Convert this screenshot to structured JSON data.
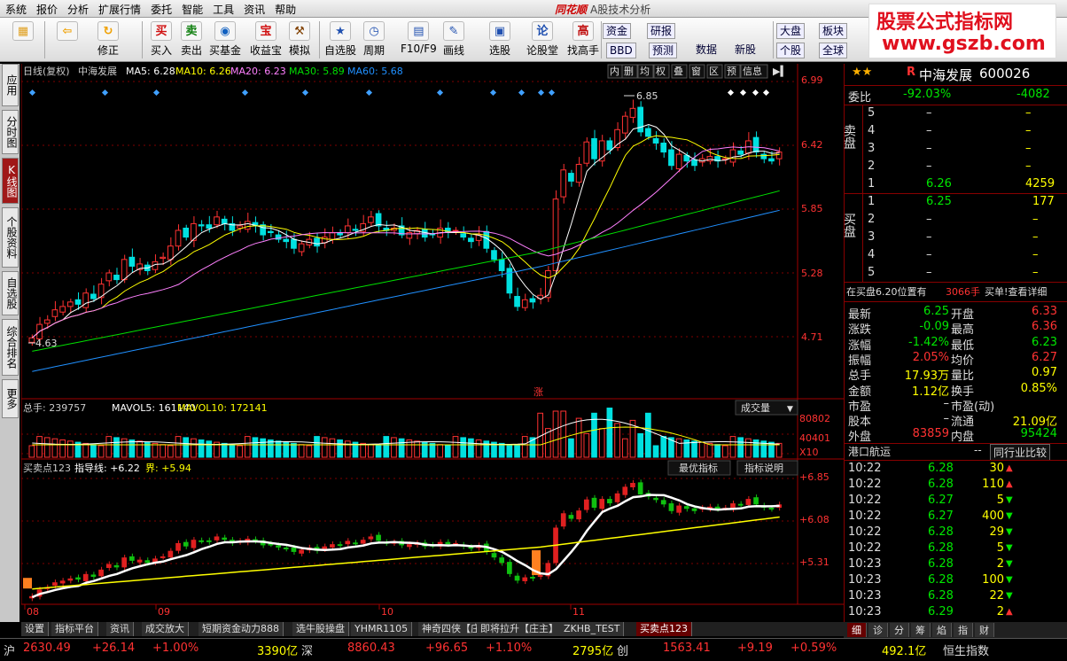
{
  "menu": [
    "系统",
    "报价",
    "分析",
    "扩展行情",
    "委托",
    "智能",
    "工具",
    "资讯",
    "帮助"
  ],
  "app_title": {
    "brand": "同花顺",
    "sub": "A股技术分析"
  },
  "watermark": {
    "line1": "股票公式指标网",
    "line2": "www.gszb.com"
  },
  "toolbar": [
    {
      "label": "",
      "icon": "grid-icon"
    },
    {
      "label": "",
      "icon": "back-arrow-icon"
    },
    {
      "label": "修正",
      "icon": "refresh-icon"
    },
    {
      "label": "买入",
      "icon": "买"
    },
    {
      "label": "卖出",
      "icon": "卖"
    },
    {
      "label": "买基金",
      "icon": "fund-icon"
    },
    {
      "label": "收益宝",
      "icon": "宝"
    },
    {
      "label": "模拟",
      "icon": "hammer-icon"
    },
    {
      "label": "自选股",
      "icon": "star-icon"
    },
    {
      "label": "周期",
      "icon": "clock-icon"
    },
    {
      "label": "F10/F9",
      "icon": "f10-icon"
    },
    {
      "label": "画线",
      "icon": "pen-icon"
    },
    {
      "label": "选股",
      "icon": "select-icon"
    },
    {
      "label": "论股堂",
      "icon": "论"
    },
    {
      "label": "找高手",
      "icon": "高"
    }
  ],
  "toolbar_small": {
    "zijin": "资金",
    "bbd": "BBD",
    "yanbao": "研报",
    "yuce": "预测",
    "shuju": "数据",
    "xinfu": "新股",
    "dapan": "大盘",
    "gegu": "个股",
    "banku": "板块",
    "quanqiu": "全球"
  },
  "left_tabs": [
    "应用",
    "分时图",
    "K线图",
    "个股资料",
    "自选股",
    "综合排名",
    "更多"
  ],
  "left_tab_active": 2,
  "kline_header": {
    "period": "日线(复权)",
    "name": "中海发展",
    "ma5": "MA5: 6.28",
    "ma10": "MA10: 6.26",
    "ma20": "MA20: 6.23",
    "ma30": "MA30: 5.89",
    "ma60": "MA60: 5.68",
    "ma5_color": "#ffffff",
    "ma10_color": "#ffff00",
    "ma20_color": "#ff80ff",
    "ma30_color": "#00e000",
    "ma60_color": "#2090ff"
  },
  "kline_tools": [
    "内",
    "删",
    "均",
    "权",
    "叠",
    "窗",
    "区",
    "预",
    "信息"
  ],
  "price_axis": [
    "6.99",
    "6.42",
    "5.85",
    "5.28",
    "4.71"
  ],
  "annotations": {
    "high": "6.85",
    "low": "4.63",
    "zhang": "涨"
  },
  "volume_header": {
    "total": "总手: 239757",
    "mavol5": "MAVOL5: 161140",
    "mavol10": "MAVOL10: 172141",
    "selector": "成交量"
  },
  "volume_axis": [
    "80802",
    "40401",
    "X10"
  ],
  "indicator_header": {
    "title": "买卖点123",
    "line": "指导线: +6.22",
    "jie": "界: +5.94",
    "btn1": "最优指标",
    "btn2": "指标说明"
  },
  "indicator_axis": [
    "+6.85",
    "+6.08",
    "+5.31"
  ],
  "date_axis": [
    "08",
    "09",
    "10",
    "11"
  ],
  "bottom_tabs": [
    "设置",
    "指标平台",
    "资讯",
    "成交放大",
    "短期资金动力888",
    "选牛股操盘",
    "YHMR1105",
    "神奇四侠【庄主】",
    "即将拉升【庄主】",
    "ZKHB_TEST",
    "买卖点123"
  ],
  "bottom_tab_active": 10,
  "quote": {
    "stars": "★★",
    "r": "R",
    "name": "中海发展",
    "code": "600026",
    "weibi_label": "委比",
    "weibi": "-92.03%",
    "weicha": "-4082",
    "sell": [
      {
        "lvl": "5",
        "price": "–",
        "vol": "–"
      },
      {
        "lvl": "4",
        "price": "–",
        "vol": "–"
      },
      {
        "lvl": "3",
        "price": "–",
        "vol": "–"
      },
      {
        "lvl": "2",
        "price": "–",
        "vol": "–"
      },
      {
        "lvl": "1",
        "price": "6.26",
        "vol": "4259"
      }
    ],
    "buy": [
      {
        "lvl": "1",
        "price": "6.25",
        "vol": "177"
      },
      {
        "lvl": "2",
        "price": "–",
        "vol": "–"
      },
      {
        "lvl": "3",
        "price": "–",
        "vol": "–"
      },
      {
        "lvl": "4",
        "price": "–",
        "vol": "–"
      },
      {
        "lvl": "5",
        "price": "–",
        "vol": "–"
      }
    ],
    "sell_label": "卖盘",
    "buy_label": "买盘",
    "notice": "在买盘6.20位置有",
    "notice_vol": "3066手",
    "notice_tail": "买单!查看详细",
    "stats": [
      {
        "l1": "最新",
        "v1": "6.25",
        "l2": "开盘",
        "v2": "6.33"
      },
      {
        "l1": "涨跌",
        "v1": "-0.09",
        "l2": "最高",
        "v2": "6.36"
      },
      {
        "l1": "涨幅",
        "v1": "-1.42%",
        "l2": "最低",
        "v2": "6.23"
      },
      {
        "l1": "振幅",
        "v1": "2.05%",
        "l2": "均价",
        "v2": "6.27"
      },
      {
        "l1": "总手",
        "v1": "17.93万",
        "l2": "量比",
        "v2": "0.97"
      },
      {
        "l1": "金额",
        "v1": "1.12亿",
        "l2": "换手",
        "v2": "0.85%"
      },
      {
        "l1": "市盈",
        "v1": "–",
        "l2": "市盈(动)",
        "v2": ""
      },
      {
        "l1": "股本",
        "v1": "–",
        "l2": "流通",
        "v2": "21.09亿"
      },
      {
        "l1": "外盘",
        "v1": "83859",
        "l2": "内盘",
        "v2": "95424"
      }
    ],
    "industry": "港口航运",
    "industry_val": "--",
    "compare": "同行业比较",
    "ticks": [
      {
        "t": "10:22",
        "p": "6.28",
        "v": "30",
        "d": "up"
      },
      {
        "t": "10:22",
        "p": "6.28",
        "v": "110",
        "d": "up"
      },
      {
        "t": "10:22",
        "p": "6.27",
        "v": "5",
        "d": "down"
      },
      {
        "t": "10:22",
        "p": "6.27",
        "v": "400",
        "d": "down"
      },
      {
        "t": "10:22",
        "p": "6.28",
        "v": "29",
        "d": "down"
      },
      {
        "t": "10:22",
        "p": "6.28",
        "v": "5",
        "d": "down"
      },
      {
        "t": "10:23",
        "p": "6.28",
        "v": "2",
        "d": "down"
      },
      {
        "t": "10:23",
        "p": "6.28",
        "v": "100",
        "d": "down"
      },
      {
        "t": "10:23",
        "p": "6.28",
        "v": "22",
        "d": "down"
      },
      {
        "t": "10:23",
        "p": "6.29",
        "v": "2",
        "d": "up"
      }
    ]
  },
  "right_tabs": [
    "细",
    "诊",
    "分",
    "筹",
    "焰",
    "指",
    "财"
  ],
  "statusbar": {
    "sh_label": "沪",
    "sh_idx": "2630.49",
    "sh_chg": "+26.14",
    "sh_pct": "+1.00%",
    "sh_amt": "3390亿",
    "sz_label": "深",
    "sz_idx": "8860.43",
    "sz_chg": "+96.65",
    "sz_pct": "+1.10%",
    "sz_amt": "2795亿",
    "cy_label": "创",
    "cy_idx": "1563.41",
    "cy_chg": "+9.19",
    "cy_pct": "+0.59%",
    "hs_amt": "492.1亿",
    "hs_label": "恒生指数"
  },
  "colors": {
    "up": "#ff3232",
    "down": "#00e0e0",
    "indicator_up": "#e02020",
    "indicator_down": "#10c010"
  }
}
